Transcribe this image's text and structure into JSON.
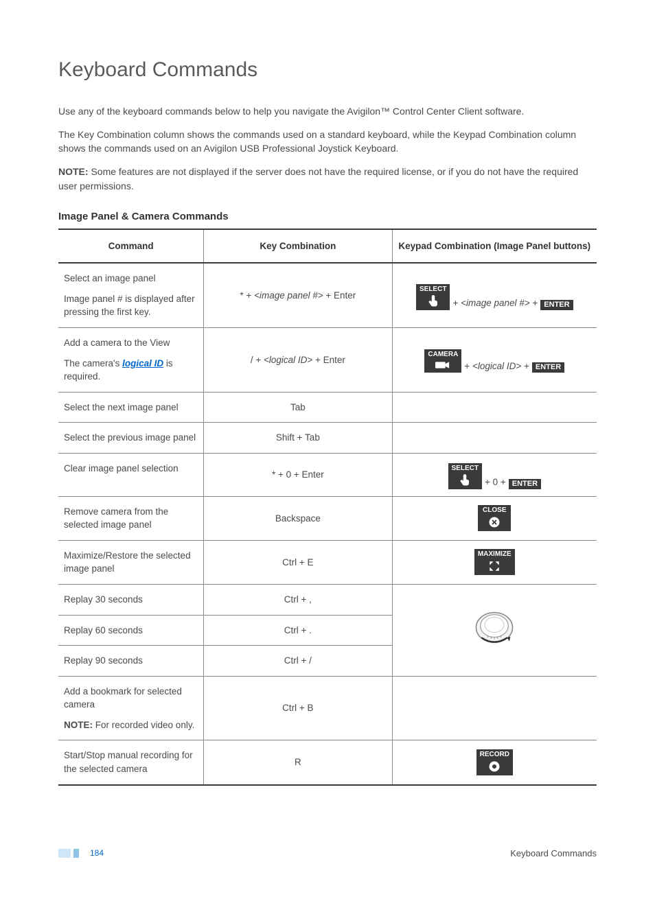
{
  "title": "Keyboard Commands",
  "intro1": "Use any of the keyboard commands below to help you navigate the Avigilon™ Control Center Client software.",
  "intro2": "The Key Combination column shows the commands used on a standard keyboard, while the Keypad Combination column shows the commands used on an Avigilon USB Professional Joystick Keyboard.",
  "note_label": "NOTE:",
  "note_text": " Some features are not displayed if the server does not have the required license, or if you do not have the required user permissions.",
  "section": "Image Panel & Camera Commands",
  "headers": {
    "c1": "Command",
    "c2": "Key Combination",
    "c3": "Keypad Combination (Image Panel buttons)"
  },
  "rows": {
    "r1": {
      "cmd_a": "Select an image panel",
      "cmd_b": "Image panel # is displayed after pressing the first key.",
      "key_pre": "* + ",
      "key_mid": "<image panel #>",
      "key_post": " + Enter",
      "pad_btn": "SELECT",
      "pad_mid": "<image panel #>",
      "pad_enter": "ENTER"
    },
    "r2": {
      "cmd_a": "Add a camera to the View",
      "cmd_b_pre": "The camera's ",
      "cmd_b_link": "logical ID",
      "cmd_b_post": " is required.",
      "key_pre": "/ + ",
      "key_mid": "<logical ID>",
      "key_post": " + Enter",
      "pad_btn": "CAMERA",
      "pad_mid": "<logical ID>",
      "pad_enter": "ENTER"
    },
    "r3": {
      "cmd": "Select the next image panel",
      "key": "Tab"
    },
    "r4": {
      "cmd": "Select the previous image panel",
      "key": "Shift + Tab"
    },
    "r5": {
      "cmd": "Clear image panel selection",
      "key": "* + 0 + Enter",
      "pad_btn": "SELECT",
      "pad_mid": " + 0 + ",
      "pad_enter": "ENTER"
    },
    "r6": {
      "cmd": "Remove camera from the selected image panel",
      "key": "Backspace",
      "pad_btn": "CLOSE"
    },
    "r7": {
      "cmd": "Maximize/Restore the selected image panel",
      "key": "Ctrl + E",
      "pad_btn": "MAXIMIZE"
    },
    "r8": {
      "cmd": "Replay 30 seconds",
      "key": "Ctrl + ,"
    },
    "r9": {
      "cmd": "Replay 60 seconds",
      "key": "Ctrl + ."
    },
    "r10": {
      "cmd": "Replay 90 seconds",
      "key": "Ctrl + /"
    },
    "r11": {
      "cmd_a": "Add a bookmark for selected camera",
      "note_label": "NOTE:",
      "note_text": " For recorded video only.",
      "key": "Ctrl + B"
    },
    "r12": {
      "cmd": "Start/Stop manual recording for the selected camera",
      "key": "R",
      "pad_btn": "RECORD"
    }
  },
  "footer": {
    "page": "184",
    "right": "Keyboard Commands"
  }
}
